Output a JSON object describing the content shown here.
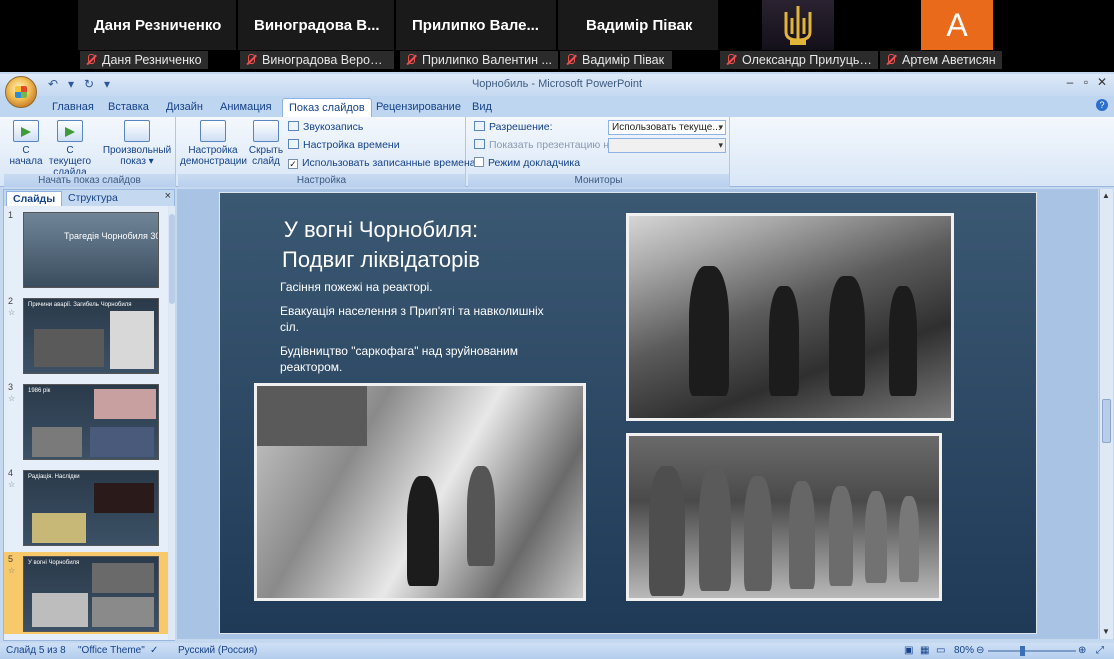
{
  "call": {
    "tiles": [
      "Даня Резниченко",
      "Виноградова  В...",
      "Прилипко  Вале...",
      "Вадимір Півак"
    ],
    "avatar_letter": "A",
    "tags": [
      "Даня Резниченко",
      "Виноградова Вероні...",
      "Прилипко Валентин ...",
      "Вадимір Півак",
      "Олександр Прилуцьк...",
      "Артем Аветисян"
    ]
  },
  "window": {
    "title": "Чорнобиль - Microsoft PowerPoint",
    "controls": [
      "–",
      "▫",
      "✕"
    ]
  },
  "tabs": [
    "Главная",
    "Вставка",
    "Дизайн",
    "Анимация",
    "Показ слайдов",
    "Рецензирование",
    "Вид"
  ],
  "ribbon": {
    "group1": {
      "label": "Начать показ слайдов",
      "btn1": [
        "С",
        "начала"
      ],
      "btn2": [
        "С текущего",
        "слайда"
      ],
      "btn3": [
        "Произвольный",
        "показ ▾"
      ]
    },
    "group2": {
      "label": "Настройка",
      "btn1": [
        "Настройка",
        "демонстрации"
      ],
      "btn2": [
        "Скрыть",
        "слайд"
      ],
      "record": "Звукозапись",
      "timing": "Настройка времени",
      "use_timings": "Использовать записанные времена"
    },
    "group3": {
      "label": "Мониторы",
      "resolution": "Разрешение:",
      "resolution_value": "Использовать текуще...",
      "show_on": "Показать презентацию на:",
      "presenter": "Режим докладчика"
    }
  },
  "pane": {
    "tab_slides": "Слайды",
    "tab_outline": "Структура",
    "close": "×",
    "thumbs": [
      {
        "num": "1",
        "text": "Трагедія Чорнобиля 30"
      },
      {
        "num": "2",
        "text": "Причини аварії. Загибель Чорнобиля"
      },
      {
        "num": "3",
        "text": "1986 рік"
      },
      {
        "num": "4",
        "text": "Радіація. Наслідки"
      },
      {
        "num": "5",
        "text": "У вогні Чорнобиля"
      }
    ]
  },
  "slide": {
    "title_line1": "У вогні Чорнобиля:",
    "title_line2": "Подвиг ліквідаторів",
    "bullets": [
      "Гасіння пожежі на реакторі.",
      "Евакуація населення з Прип'яті та навколишніх сіл.",
      "Будівництво \"саркофага\" над зруйнованим реактором."
    ]
  },
  "status": {
    "slide_info": "Слайд 5 из 8",
    "theme": "\"Office Theme\"",
    "language": "Русский (Россия)",
    "zoom": "80%"
  }
}
